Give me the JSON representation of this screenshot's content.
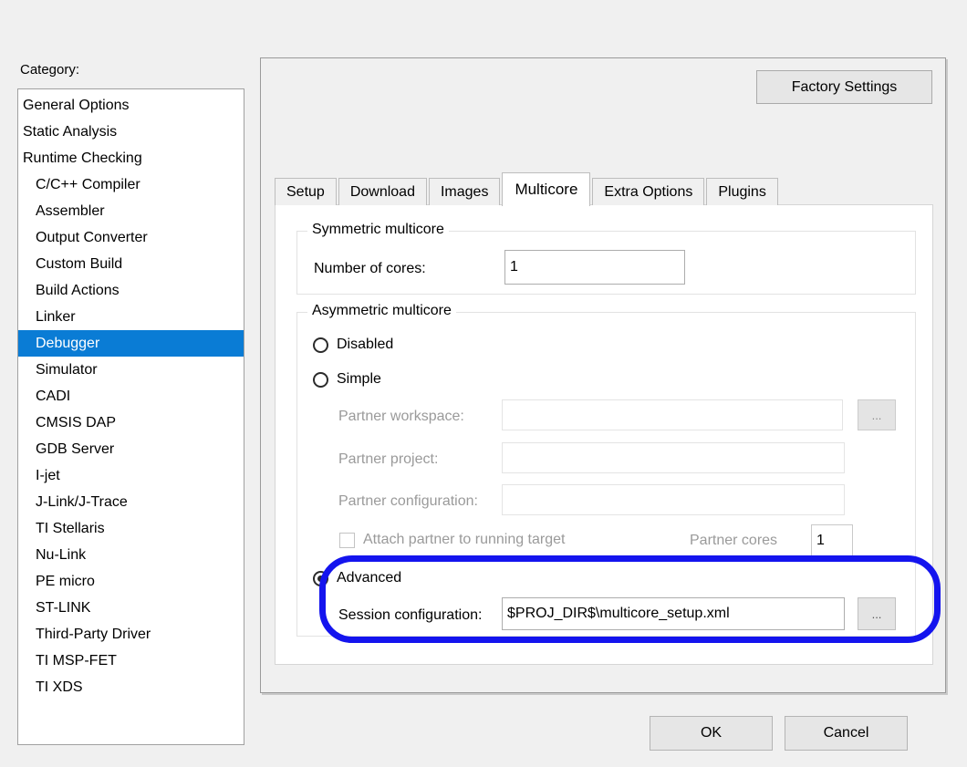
{
  "sidebar": {
    "label": "Category:",
    "selected": "Debugger",
    "items": [
      {
        "label": "General Options",
        "indent": false
      },
      {
        "label": "Static Analysis",
        "indent": false
      },
      {
        "label": "Runtime Checking",
        "indent": false
      },
      {
        "label": "C/C++ Compiler",
        "indent": true
      },
      {
        "label": "Assembler",
        "indent": true
      },
      {
        "label": "Output Converter",
        "indent": true
      },
      {
        "label": "Custom Build",
        "indent": true
      },
      {
        "label": "Build Actions",
        "indent": true
      },
      {
        "label": "Linker",
        "indent": true
      },
      {
        "label": "Debugger",
        "indent": true
      },
      {
        "label": "Simulator",
        "indent": true
      },
      {
        "label": "CADI",
        "indent": true
      },
      {
        "label": "CMSIS DAP",
        "indent": true
      },
      {
        "label": "GDB Server",
        "indent": true
      },
      {
        "label": "I-jet",
        "indent": true
      },
      {
        "label": "J-Link/J-Trace",
        "indent": true
      },
      {
        "label": "TI Stellaris",
        "indent": true
      },
      {
        "label": "Nu-Link",
        "indent": true
      },
      {
        "label": "PE micro",
        "indent": true
      },
      {
        "label": "ST-LINK",
        "indent": true
      },
      {
        "label": "Third-Party Driver",
        "indent": true
      },
      {
        "label": "TI MSP-FET",
        "indent": true
      },
      {
        "label": "TI XDS",
        "indent": true
      }
    ]
  },
  "panel": {
    "factory_settings_label": "Factory Settings",
    "tabs": [
      {
        "label": "Setup",
        "active": false
      },
      {
        "label": "Download",
        "active": false
      },
      {
        "label": "Images",
        "active": false
      },
      {
        "label": "Multicore",
        "active": true
      },
      {
        "label": "Extra Options",
        "active": false
      },
      {
        "label": "Plugins",
        "active": false
      }
    ]
  },
  "symmetric": {
    "title": "Symmetric multicore",
    "cores_label": "Number of cores:",
    "cores_value": "1"
  },
  "asymmetric": {
    "title": "Asymmetric multicore",
    "disabled_option": "Disabled",
    "simple_option": "Simple",
    "partner_workspace_label": "Partner workspace:",
    "partner_workspace_value": "",
    "partner_project_label": "Partner project:",
    "partner_project_value": "",
    "partner_configuration_label": "Partner configuration:",
    "partner_configuration_value": "",
    "attach_partner_label": "Attach partner to running target",
    "partner_cores_label": "Partner cores",
    "partner_cores_value": "1",
    "advanced_option": "Advanced",
    "session_configuration_label": "Session configuration:",
    "session_configuration_value": "$PROJ_DIR$\\multicore_setup.xml",
    "browse_label": "...",
    "selected_mode": "Advanced",
    "highlight_color": "#1414ee"
  },
  "footer": {
    "ok_label": "OK",
    "cancel_label": "Cancel"
  }
}
